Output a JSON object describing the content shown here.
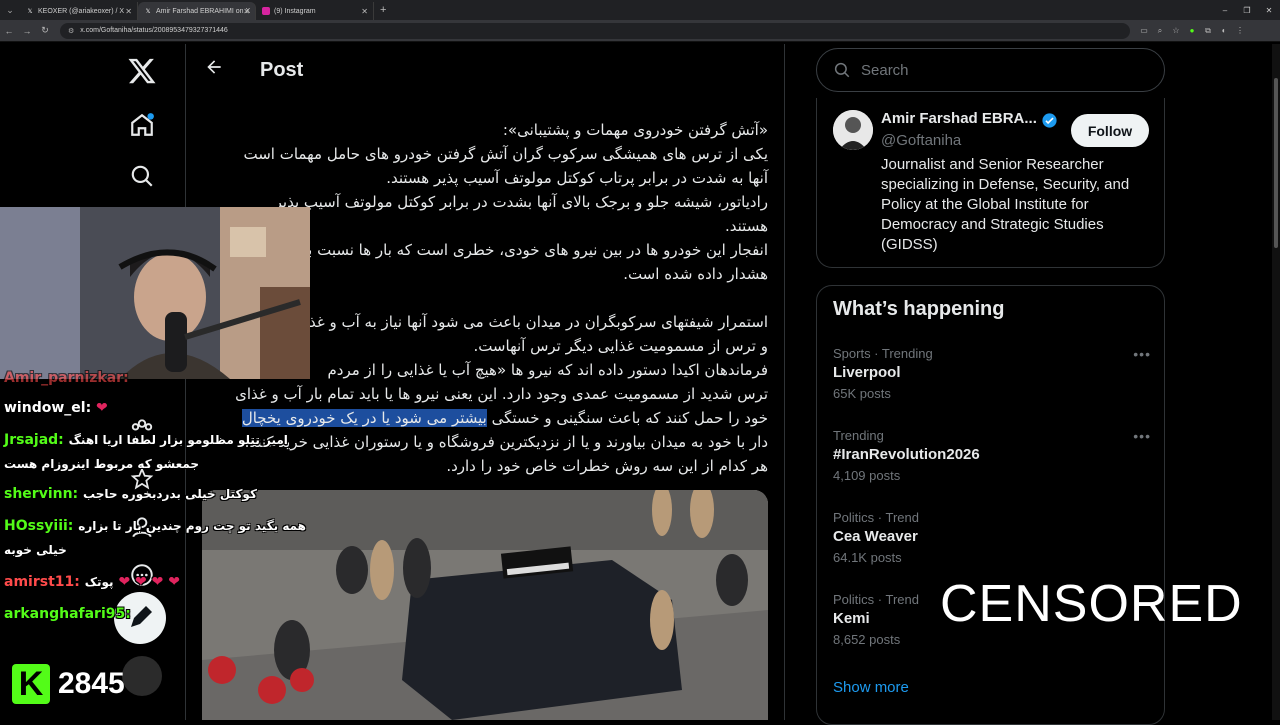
{
  "browser": {
    "tabs": [
      {
        "title": "KEOXER (@ariakeoxer) / X",
        "icon": "x-icon",
        "active": false
      },
      {
        "title": "Amir Farshad EBRAHIMI on X",
        "icon": "x-icon",
        "active": true
      },
      {
        "title": "(9) Instagram",
        "icon": "instagram-icon",
        "active": false
      }
    ],
    "url": "x.com/Goftaniha/status/2008953479327371446"
  },
  "post": {
    "header": "Post",
    "paragraphs": [
      "«آتش گرفتن خودروی مهمات و پشتیبانی»:",
      "یکی از ترس های همیشگی سرکوب گران آتش گرفتن خودرو های حامل مهمات است",
      "آنها به شدت در برابر پرتاب کوکتل مولوتف آسیب پذیر هستند.",
      "رادیاتور، شیشه جلو و برجک بالای آنها بشدت در برابر کوکتل مولوتف آسیب پذیر",
      "هستند.",
      "انفجار این خودرو ها در بین نیرو های خودی، خطری است که بار ها نسبت به آن",
      "هشدار داده شده است.",
      "",
      "استمرار شیفتهای سرکوبگران در میدان باعث می شود آنها نیاز به آب و غذا",
      "و ترس از مسمومیت غذایی دیگر ترس آنهاست.",
      "فرماندهان اکیدا دستور داده اند که نیرو ها «هیچ آب یا غذایی را از مردم",
      "ترس شدید از مسمومیت عمدی وجود دارد. این یعنی نیرو ها یا باید تمام بار آب و غذای",
      "خود را حمل کنند که باعث سنگینی و خستگی بیشتر می شود یا در یک خودروی یخچال",
      "دار با خود به میدان بیاورند و یا از نزدیکترین فروشگاه و یا رستوران غذایی خرید کنند.",
      "هر کدام از این سه روش خطرات خاص خود را دارد."
    ],
    "highlight": "بیشتر می شود یا در یک خودروی یخچال"
  },
  "search": {
    "placeholder": "Search"
  },
  "profile": {
    "name": "Amir Farshad EBRA...",
    "handle": "@Goftaniha",
    "follow_label": "Follow",
    "bio": "Journalist and Senior Researcher specializing in Defense, Security, and Policy at the Global Institute for Democracy and Strategic Studies (GIDSS)"
  },
  "trends": {
    "title": "What’s happening",
    "items": [
      {
        "category": "Sports · Trending",
        "name": "Liverpool",
        "count": "65K posts"
      },
      {
        "category": "Trending",
        "name": "#IranRevolution2026",
        "count": "4,109 posts"
      },
      {
        "category": "Politics · Trend",
        "name": "Cea Weaver",
        "count": "64.1K posts"
      },
      {
        "category": "Politics · Trend",
        "name": "Kemi",
        "count": "8,652 posts"
      }
    ],
    "show_more": "Show more"
  },
  "stream": {
    "chat": [
      {
        "user": "Amir_parnizkar:",
        "msg": "",
        "color": "#ff4b4b"
      },
      {
        "user": "window_el:",
        "msg": "",
        "color": "#ffffff"
      },
      {
        "user": "Jrsajad:",
        "msg": "امیر تتلو مظلومو بزار لطفا اریا اهنگ",
        "color": "#53fc18"
      },
      {
        "user": "",
        "msg": "جمعشو که مربوط اینروزام هست",
        "color": "#ffffff"
      },
      {
        "user": "shervinn:",
        "msg": "کوکتل خیلی بدردبخوره حاجب",
        "color": "#53fc18"
      },
      {
        "user": "HOssyiii:",
        "msg": "همه بگید تو چت روم چندین بار تا بزاره",
        "color": "#53fc18"
      },
      {
        "user": "",
        "msg": "خیلی خوبه",
        "color": "#ffffff"
      },
      {
        "user": "amirst11:",
        "msg": "پوتک",
        "color": "#ff4b4b"
      },
      {
        "user": "arkanghafari95:",
        "msg": "",
        "color": "#53fc18"
      }
    ],
    "censored": "CENSORED",
    "kick_count": "2845",
    "kick_logo": "K",
    "colors": {
      "kick_green": "#53fc18",
      "x_blue": "#1d9bf0"
    }
  }
}
